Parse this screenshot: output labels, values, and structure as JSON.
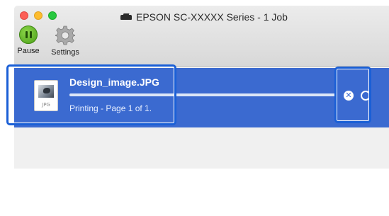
{
  "window": {
    "title": "EPSON SC-XXXXX Series - 1 Job"
  },
  "toolbar": {
    "pause_label": "Pause",
    "settings_label": "Settings"
  },
  "job": {
    "file_name": "Design_image.JPG",
    "file_ext": "JPG",
    "status": "Printing - Page 1 of 1.",
    "progress": 1.0
  },
  "icons": {
    "printer": "printer-icon",
    "pause": "pause-icon",
    "settings": "gear-icon",
    "cancel": "cancel-icon",
    "info": "magnifier-icon"
  },
  "colors": {
    "selection": "#3b6ad0",
    "callout": "#1a5fd6"
  }
}
